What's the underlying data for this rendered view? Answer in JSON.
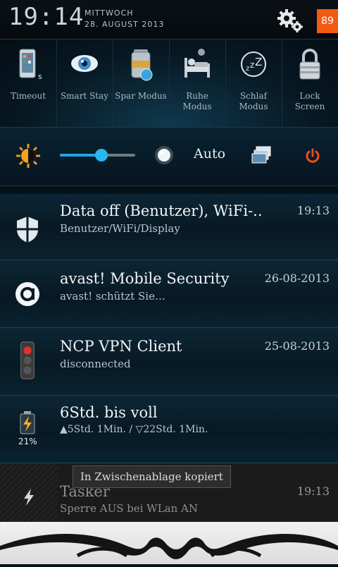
{
  "status": {
    "time": "19:14",
    "day": "MITTWOCH",
    "date": "28. AUGUST 2013",
    "battery_badge": "89"
  },
  "toggles": [
    {
      "label": "Timeout",
      "icon": "phone-timeout-icon"
    },
    {
      "label": "Smart Stay",
      "icon": "eye-icon"
    },
    {
      "label": "Spar Modus",
      "icon": "battery-saver-icon"
    },
    {
      "label": "Ruhe\nModus",
      "icon": "bed-icon"
    },
    {
      "label": "Schlaf\nModus",
      "icon": "sleep-zzz-icon"
    },
    {
      "label": "Lock\nScreen",
      "icon": "padlock-icon"
    }
  ],
  "brightness": {
    "level_percent": 55,
    "auto_label": "Auto",
    "accent_color": "#1fa5e6"
  },
  "notifications": [
    {
      "title": "Data off (Benutzer), WiFi-..",
      "subtitle": "Benutzer/WiFi/Display",
      "time": "19:13",
      "icon": "shield-icon"
    },
    {
      "title": "avast! Mobile Security",
      "subtitle": "avast! schützt Sie…",
      "time": "26-08-2013",
      "icon": "avast-icon"
    },
    {
      "title": "NCP VPN Client",
      "subtitle": "disconnected",
      "time": "25-08-2013",
      "icon": "traffic-light-icon"
    },
    {
      "title": "6Std. bis voll",
      "subtitle": "▲5Std. 1Min. / ▽22Std. 1Min.",
      "time": "",
      "icon": "battery-charging-icon",
      "icon_label": "21%"
    },
    {
      "title": "Tasker",
      "subtitle": "Sperre AUS bei WLan AN",
      "time": "19:13",
      "icon": "lightning-icon"
    }
  ],
  "toast": "In Zwischenablage kopiert"
}
